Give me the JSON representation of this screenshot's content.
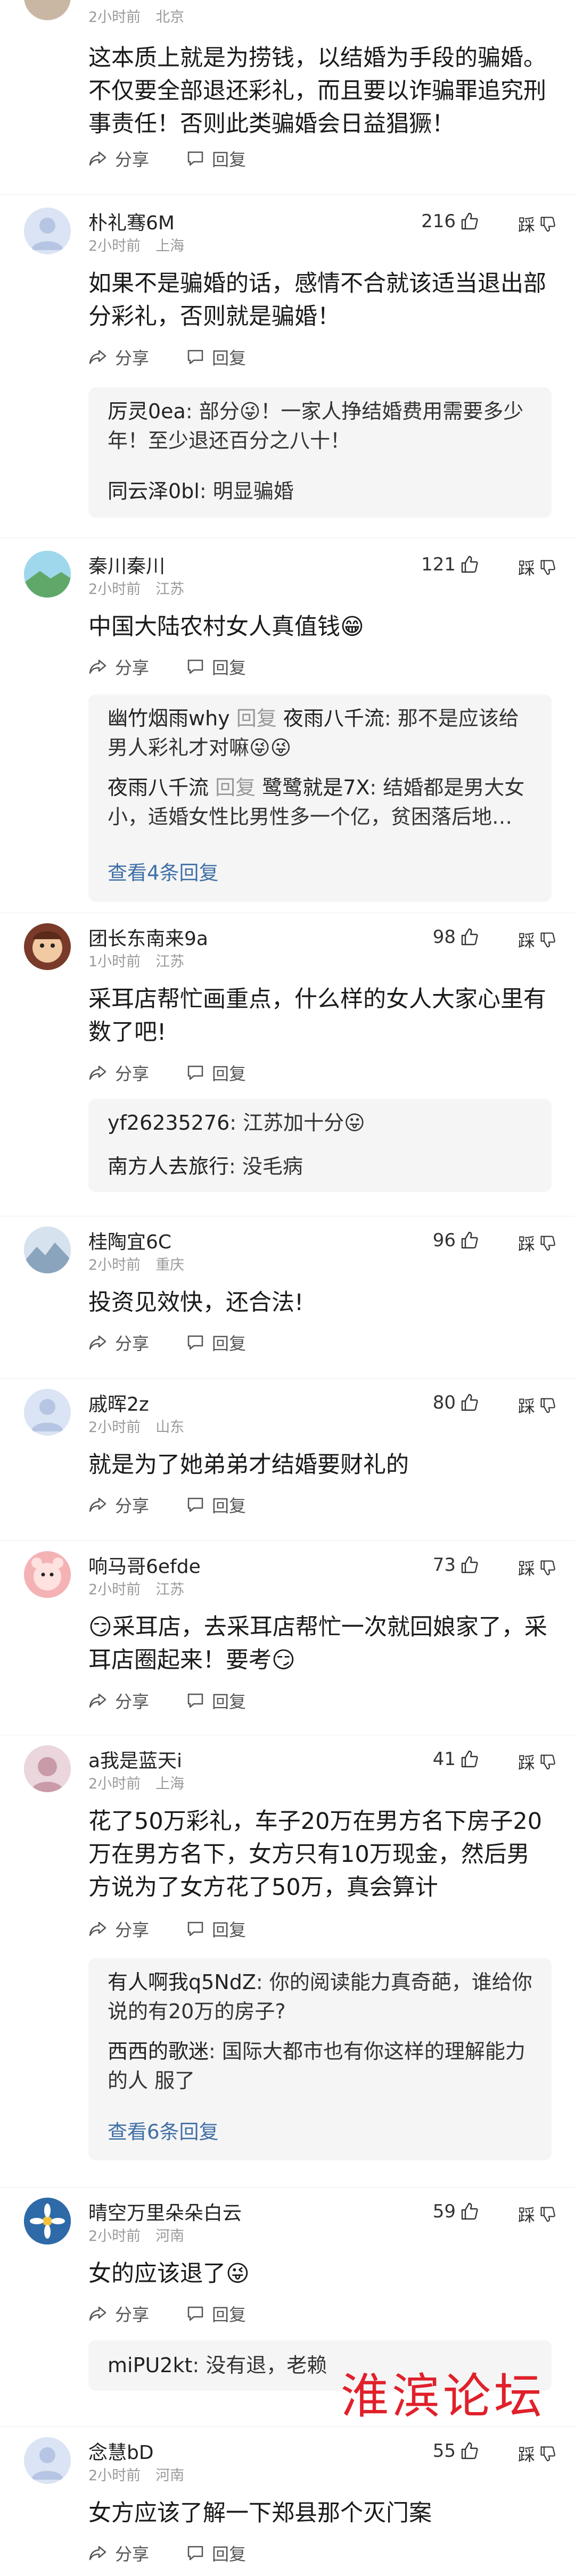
{
  "top_comment": {
    "meta": {
      "time": "2小时前",
      "location": "北京"
    },
    "body": "这本质上就是为捞钱，以结婚为手段的骗婚。不仅要全部退还彩礼，而且要以诈骗罪追究刑事责任！否则此类骗婚会日益猖獗！",
    "share": "分享",
    "reply": "回复"
  },
  "comments": [
    {
      "user": "朴礼骞6M",
      "time": "2小时前",
      "location": "上海",
      "likes": "216",
      "dislike": "踩",
      "body": "如果不是骗婚的话，感情不合就该适当退出部分彩礼，否则就是骗婚！",
      "share": "分享",
      "reply": "回复",
      "replies": [
        {
          "name": "厉灵0ea",
          "text": ": 部分😜！一家人挣结婚费用需要多少年！至少退还百分之八十！"
        },
        {
          "name": "同云泽0bl",
          "text": ": 明显骗婚"
        }
      ]
    },
    {
      "user": "秦川秦川",
      "time": "2小时前",
      "location": "江苏",
      "likes": "121",
      "dislike": "踩",
      "body": "中国大陆农村女人真值钱😁",
      "share": "分享",
      "reply": "回复",
      "replies": [
        {
          "name": "幽竹烟雨why",
          "mid": " 回复 ",
          "name2": "夜雨八千流",
          "text": ": 那不是应该给男人彩礼才对嘛😜😜"
        },
        {
          "name": "夜雨八千流",
          "mid": " 回复 ",
          "name2": "鹭鹭就是7X",
          "text": ": 结婚都是男大女小，适婚女性比男性多一个亿，贫困落后地…"
        }
      ],
      "more": "查看4条回复"
    },
    {
      "user": "团长东南来9a",
      "time": "1小时前",
      "location": "江苏",
      "likes": "98",
      "dislike": "踩",
      "body": "采耳店帮忙画重点，什么样的女人大家心里有数了吧!",
      "share": "分享",
      "reply": "回复",
      "replies": [
        {
          "name": "yf26235276",
          "text": ": 江苏加十分😛"
        },
        {
          "name": "南方人去旅行",
          "text": ": 没毛病"
        }
      ]
    },
    {
      "user": "桂陶宜6C",
      "time": "2小时前",
      "location": "重庆",
      "likes": "96",
      "dislike": "踩",
      "body": "投资见效快，还合法!",
      "share": "分享",
      "reply": "回复"
    },
    {
      "user": "戚晖2z",
      "time": "2小时前",
      "location": "山东",
      "likes": "80",
      "dislike": "踩",
      "body": "就是为了她弟弟才结婚要财礼的",
      "share": "分享",
      "reply": "回复"
    },
    {
      "user": "响马哥6efde",
      "time": "2小时前",
      "location": "江苏",
      "likes": "73",
      "dislike": "踩",
      "body": "😏采耳店，去采耳店帮忙一次就回娘家了，采耳店圈起来！要考😏",
      "share": "分享",
      "reply": "回复"
    },
    {
      "user": "a我是蓝天i",
      "time": "2小时前",
      "location": "上海",
      "likes": "41",
      "dislike": "踩",
      "body": "花了50万彩礼，车子20万在男方名下房子20万在男方名下，女方只有10万现金，然后男方说为了女方花了50万，真会算计",
      "share": "分享",
      "reply": "回复",
      "replies": [
        {
          "name": "有人啊我q5NdZ",
          "text": ": 你的阅读能力真奇葩，谁给你说的有20万的房子?"
        },
        {
          "name": "西西的歌迷",
          "text": ": 国际大都市也有你这样的理解能力的人 服了"
        }
      ],
      "more": "查看6条回复"
    },
    {
      "user": "晴空万里朵朵白云",
      "time": "2小时前",
      "location": "河南",
      "likes": "59",
      "dislike": "踩",
      "body": "女的应该退了😜",
      "share": "分享",
      "reply": "回复",
      "replies": [
        {
          "name": "miPU2kt",
          "text": ": 没有退，老赖"
        }
      ]
    },
    {
      "user": "念慧bD",
      "time": "2小时前",
      "location": "河南",
      "likes": "55",
      "dislike": "踩",
      "body": "女方应该了解一下郑县那个灭门案",
      "share": "分享",
      "reply": "回复"
    }
  ],
  "watermark": "淮滨论坛",
  "colors": {
    "link": "#3f6fa6",
    "meta": "#9a9a9a",
    "reply_bg": "#f5f5f5",
    "watermark": "#e0202a"
  }
}
